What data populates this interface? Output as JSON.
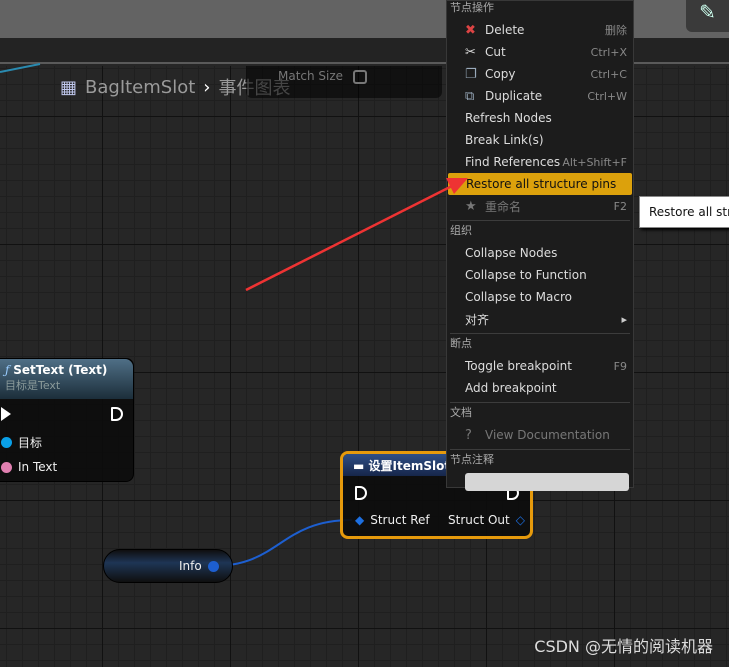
{
  "breadcrumb": {
    "blueprint": "BagItemSlot",
    "graph": "事件图表"
  },
  "match_size": {
    "label": "Match Size",
    "checked": false
  },
  "nodes": {
    "settext": {
      "title": "SetText (Text)",
      "subtitle": "目标是Text",
      "pins": [
        "目标",
        "In Text"
      ]
    },
    "set_struct": {
      "title": "设置ItemSlot",
      "in_pin": "Struct Ref",
      "out_pin": "Struct Out"
    },
    "info": {
      "label": "Info"
    }
  },
  "menu": {
    "sections": {
      "node_ops": "节点操作",
      "organize": "组织",
      "breakpoints": "断点",
      "docs": "文档",
      "comment": "节点注释"
    },
    "items": [
      {
        "label": "Delete",
        "shortcut": "删除",
        "icon": "delete-icon"
      },
      {
        "label": "Cut",
        "shortcut": "Ctrl+X",
        "icon": "scissors-icon"
      },
      {
        "label": "Copy",
        "shortcut": "Ctrl+C",
        "icon": "copy-icon"
      },
      {
        "label": "Duplicate",
        "shortcut": "Ctrl+W",
        "icon": "duplicate-icon"
      },
      {
        "label": "Refresh Nodes"
      },
      {
        "label": "Break Link(s)"
      },
      {
        "label": "Find References",
        "shortcut": "Alt+Shift+F"
      },
      {
        "label": "Restore all structure pins",
        "highlighted": true
      },
      {
        "label": "重命名",
        "shortcut": "F2",
        "icon": "rename-icon",
        "disabled": true
      },
      {
        "label": "Collapse Nodes"
      },
      {
        "label": "Collapse to Function"
      },
      {
        "label": "Collapse to Macro"
      },
      {
        "label": "对齐"
      },
      {
        "label": "Toggle breakpoint",
        "shortcut": "F9"
      },
      {
        "label": "Add breakpoint"
      },
      {
        "label": "View Documentation",
        "icon": "help-icon",
        "disabled": true
      }
    ]
  },
  "tooltip": "Restore all structure pins",
  "watermark": "CSDN @无情的阅读机器",
  "colors": {
    "highlight": "#dca10c",
    "selection": "#e69a0c",
    "struct_pin": "#1d5fd0",
    "text_pin": "#e07fb0",
    "object_pin": "#0aa0e8",
    "arrow": "#ee3333"
  }
}
